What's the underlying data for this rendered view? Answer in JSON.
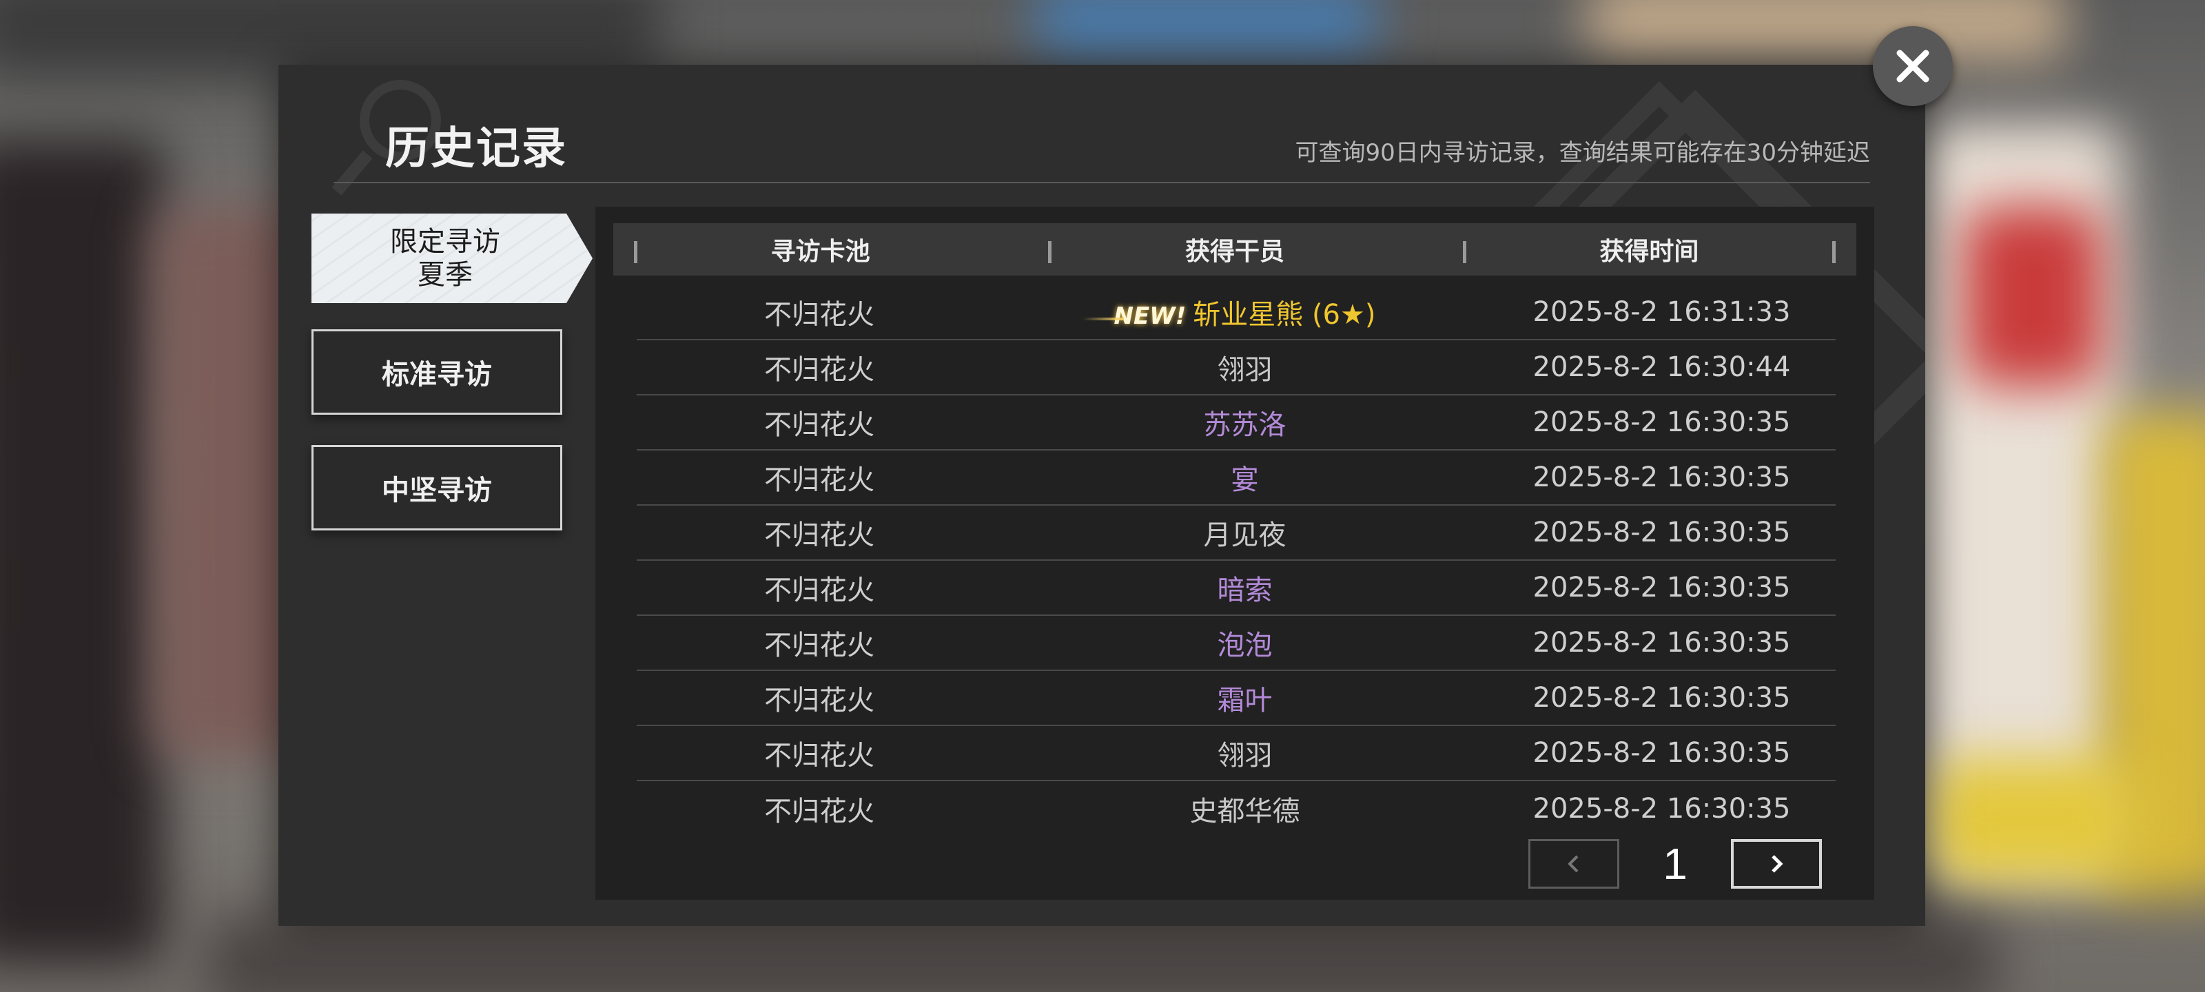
{
  "dialog": {
    "title": "历史记录",
    "notice": "可查询90日内寻访记录，查询结果可能存在30分钟延迟"
  },
  "tabs": [
    {
      "line1": "限定寻访",
      "line2": "夏季",
      "active": true
    },
    {
      "label": "标准寻访",
      "active": false
    },
    {
      "label": "中坚寻访",
      "active": false
    }
  ],
  "table": {
    "headers": [
      "寻访卡池",
      "获得干员",
      "获得时间"
    ],
    "rows": [
      {
        "pool": "不归花火",
        "operator": "斩业星熊 (6★)",
        "time": "2025-8-2 16:31:33",
        "rarity": "gold",
        "new": "NEW!"
      },
      {
        "pool": "不归花火",
        "operator": "翎羽",
        "time": "2025-8-2 16:30:44",
        "rarity": "white"
      },
      {
        "pool": "不归花火",
        "operator": "苏苏洛",
        "time": "2025-8-2 16:30:35",
        "rarity": "purple"
      },
      {
        "pool": "不归花火",
        "operator": "宴",
        "time": "2025-8-2 16:30:35",
        "rarity": "purple"
      },
      {
        "pool": "不归花火",
        "operator": "月见夜",
        "time": "2025-8-2 16:30:35",
        "rarity": "white"
      },
      {
        "pool": "不归花火",
        "operator": "暗索",
        "time": "2025-8-2 16:30:35",
        "rarity": "purple"
      },
      {
        "pool": "不归花火",
        "operator": "泡泡",
        "time": "2025-8-2 16:30:35",
        "rarity": "purple"
      },
      {
        "pool": "不归花火",
        "operator": "霜叶",
        "time": "2025-8-2 16:30:35",
        "rarity": "purple"
      },
      {
        "pool": "不归花火",
        "operator": "翎羽",
        "time": "2025-8-2 16:30:35",
        "rarity": "white"
      },
      {
        "pool": "不归花火",
        "operator": "史都华德",
        "time": "2025-8-2 16:30:35",
        "rarity": "white"
      }
    ]
  },
  "pager": {
    "current_page": "1",
    "prev_icon": "chevron-left-icon",
    "next_icon": "chevron-right-icon"
  },
  "close_icon": "close-icon",
  "colors": {
    "dialog_bg": "#2e2e2e",
    "panel_bg": "#212121",
    "header_bg": "#383838",
    "six_star": "#f0c62f",
    "four_star": "#b38ad8",
    "three_star": "#c9c9c9"
  }
}
